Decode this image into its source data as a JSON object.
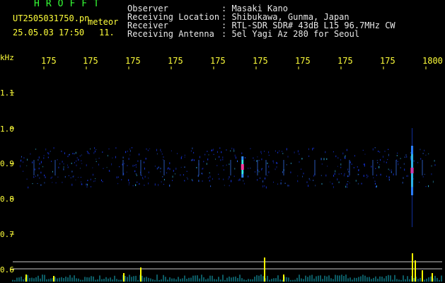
{
  "title_banner": "HROFFT",
  "file": {
    "name": "UT2505031750.pn",
    "type": "meteor",
    "datetime": "25.05.03 17:50",
    "count": "11."
  },
  "info": [
    {
      "label": "Observer",
      "value": ": Masaki Kano"
    },
    {
      "label": "Receiving Location",
      "value": ": Shibukawa, Gunma, Japan"
    },
    {
      "label": "Receiver",
      "value": ": RTL-SDR SDR# 43dB L15 96.7MHz CW"
    },
    {
      "label": "Receiving Antenna",
      "value": ": 5el Yagi Az 280 for Seoul"
    }
  ],
  "chart_data": {
    "type": "heatmap",
    "ylabel": "kHz",
    "y_ticks": [
      "1.1",
      "1.0",
      "0.9",
      "0.8",
      "0.7",
      "0.6"
    ],
    "x_ticks": [
      "175",
      "175",
      "175",
      "175",
      "175",
      "175",
      "175",
      "175",
      "175",
      "1800"
    ],
    "ylim": [
      0.57,
      1.17
    ],
    "signal_band_khz": 0.89,
    "bright_events": [
      {
        "time_fraction": 0.535,
        "freq_khz": 0.89,
        "intensity": "medium"
      },
      {
        "time_fraction": 0.93,
        "freq_khz": 0.88,
        "intensity": "strong"
      }
    ]
  },
  "colors": {
    "background": "#000000",
    "axis_text": "#ffff3a",
    "header_text": "#e8e8e8",
    "banner": "#35ff35",
    "trace": "#ffff00",
    "noise": "#1a3cff"
  }
}
